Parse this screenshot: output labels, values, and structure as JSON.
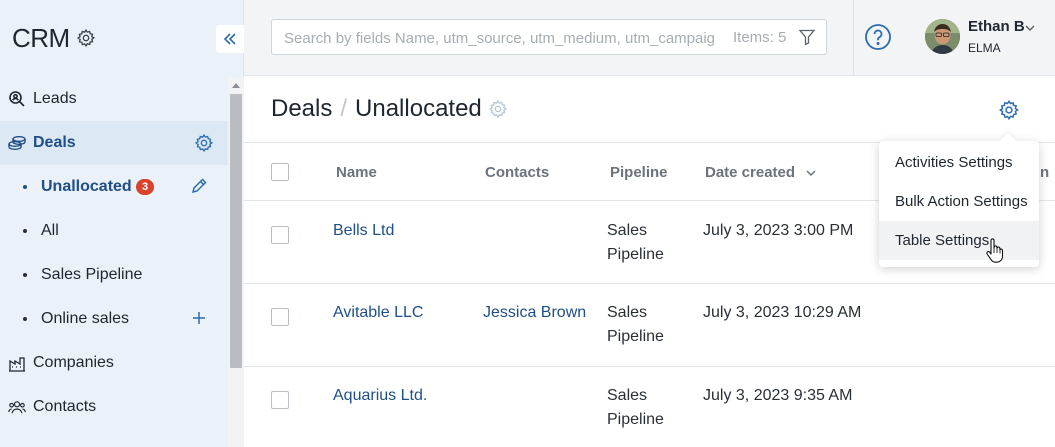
{
  "sidebar": {
    "app_title": "CRM",
    "nav": {
      "leads": "Leads",
      "deals": "Deals",
      "companies": "Companies",
      "contacts": "Contacts"
    },
    "deals_sub": {
      "unallocated": "Unallocated",
      "unallocated_badge": "3",
      "all": "All",
      "sales_pipeline": "Sales Pipeline",
      "online_sales": "Online sales"
    }
  },
  "topbar": {
    "search_placeholder": "Search by fields Name, utm_source, utm_medium, utm_campaign",
    "items_count": "Items: 5",
    "user_name": "Ethan B",
    "user_org": "ELMA"
  },
  "page": {
    "breadcrumb_root": "Deals",
    "breadcrumb_sep": "/",
    "breadcrumb_current": "Unallocated"
  },
  "table": {
    "headers": {
      "name": "Name",
      "contacts": "Contacts",
      "pipeline": "Pipeline",
      "date_created": "Date created"
    },
    "rows": [
      {
        "name": "Bells Ltd",
        "contact": "",
        "pipeline_l1": "Sales",
        "pipeline_l2": "Pipeline",
        "date": "July 3, 2023 3:00 PM"
      },
      {
        "name": "Avitable LLC",
        "contact": "Jessica Brown",
        "pipeline_l1": "Sales",
        "pipeline_l2": "Pipeline",
        "date": "July 3, 2023 10:29 AM"
      },
      {
        "name": "Aquarius Ltd.",
        "contact": "",
        "pipeline_l1": "Sales",
        "pipeline_l2": "Pipeline",
        "date": "July 3, 2023 9:35 AM"
      }
    ],
    "clipped_header_fragment": "n"
  },
  "settings_menu": {
    "items": [
      "Activities Settings",
      "Bulk Action Settings",
      "Table Settings"
    ]
  },
  "colors": {
    "accent": "#2b6cb0",
    "link": "#1f4f86",
    "badge": "#d9432b",
    "sidebar_bg": "#eaf1f8"
  }
}
